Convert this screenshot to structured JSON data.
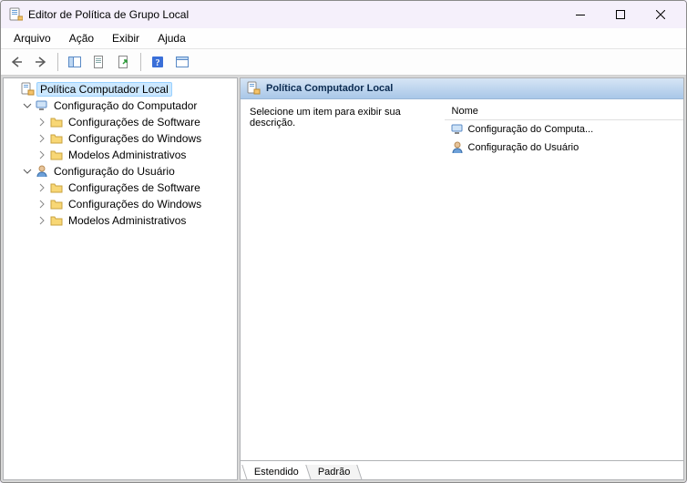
{
  "window": {
    "title": "Editor de Política de Grupo Local"
  },
  "menu": {
    "arquivo": "Arquivo",
    "acao": "Ação",
    "exibir": "Exibir",
    "ajuda": "Ajuda"
  },
  "tree": {
    "root": "Política Computador Local",
    "computer": {
      "label": "Configuração do Computador",
      "sw": "Configurações de Software",
      "win": "Configurações do Windows",
      "adm": "Modelos Administrativos"
    },
    "user": {
      "label": "Configuração do Usuário",
      "sw": "Configurações de Software",
      "win": "Configurações do Windows",
      "adm": "Modelos Administrativos"
    }
  },
  "right": {
    "header": "Política Computador Local",
    "desc": "Selecione um item para exibir sua descrição.",
    "col_name": "Nome",
    "items": {
      "0": "Configuração do Computa...",
      "1": "Configuração do Usuário"
    }
  },
  "tabs": {
    "ext": "Estendido",
    "std": "Padrão"
  }
}
